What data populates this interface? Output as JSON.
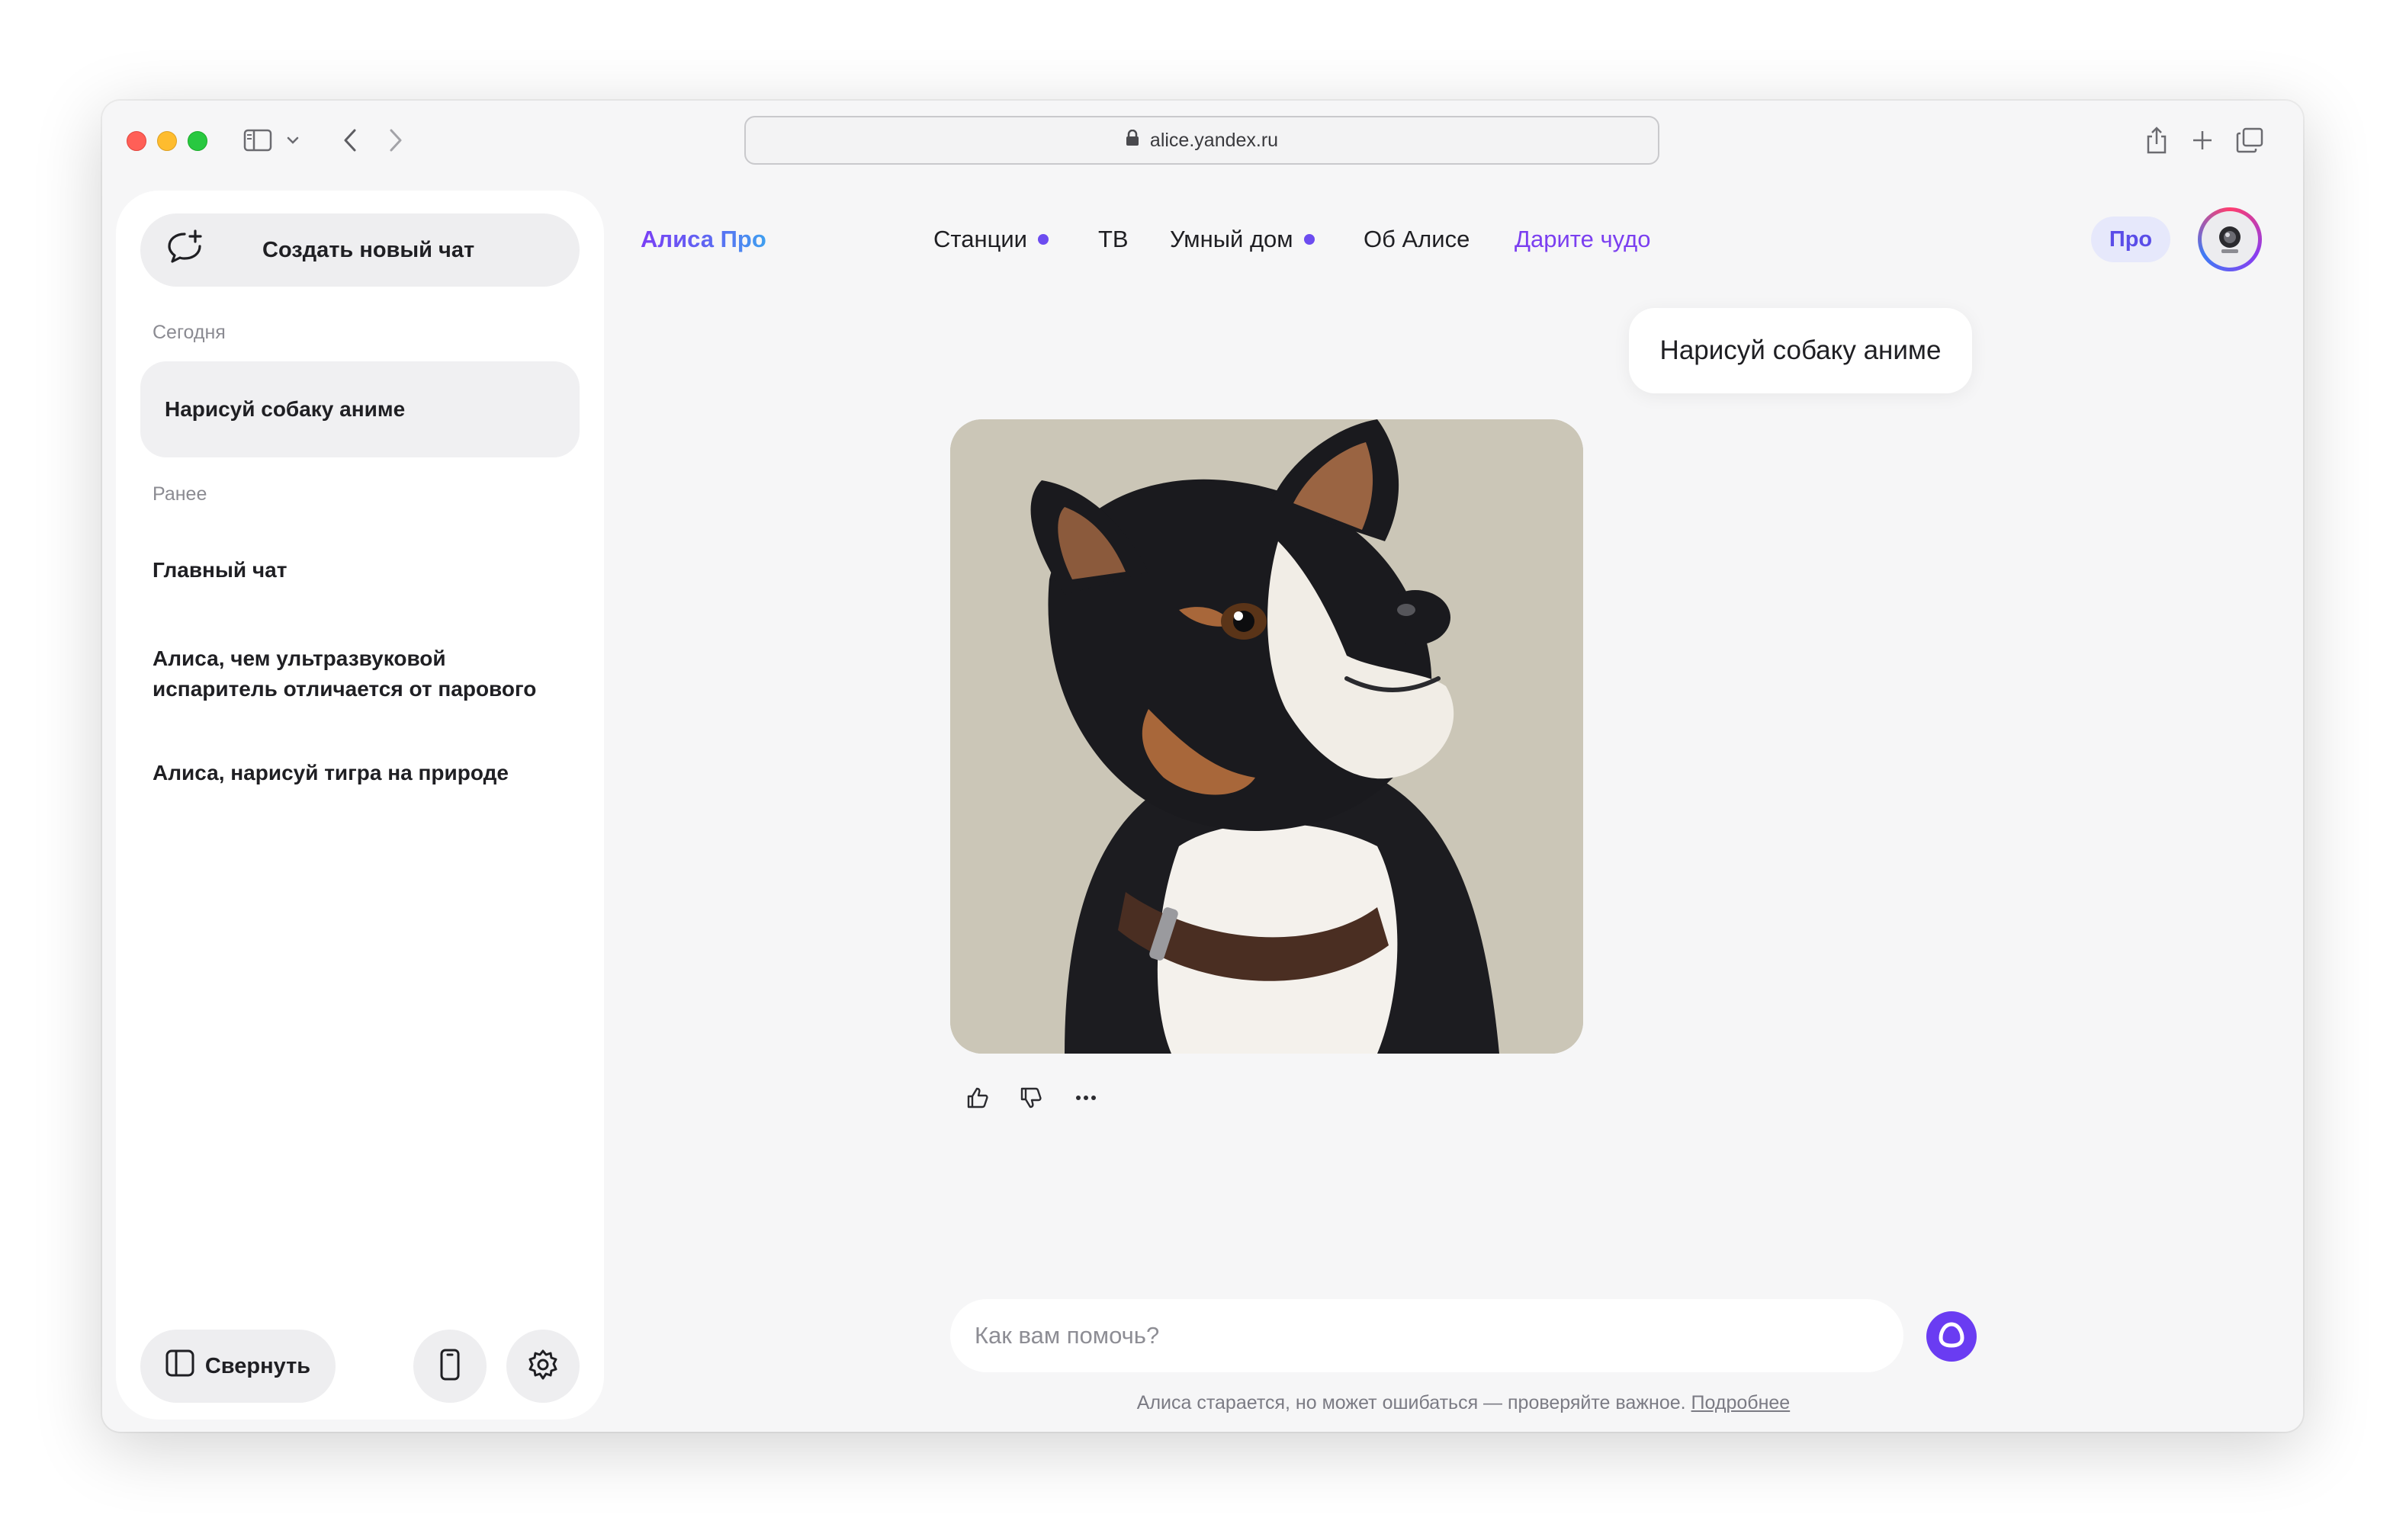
{
  "browser": {
    "url": "alice.yandex.ru"
  },
  "sidebar": {
    "new_chat_label": "Создать новый чат",
    "today_label": "Сегодня",
    "active_chat": "Нарисуй собаку аниме",
    "earlier_label": "Ранее",
    "chats": [
      "Главный чат",
      "Алиса, чем ультразвуковой испаритель отличается от парового",
      "Алиса, нарисуй тигра на природе"
    ],
    "collapse_label": "Свернуть"
  },
  "header": {
    "brand": "Алиса Про",
    "nav": [
      {
        "label": "Станции",
        "dot": true
      },
      {
        "label": "ТВ",
        "dot": false
      },
      {
        "label": "Умный дом",
        "dot": true
      },
      {
        "label": "Об Алисе",
        "dot": false
      },
      {
        "label": "Дарите чудо",
        "dot": false
      }
    ],
    "pro_badge": "Про"
  },
  "chat": {
    "user_message": "Нарисуй собаку аниме",
    "image_subject": "anime-style dog portrait"
  },
  "composer": {
    "placeholder": "Как вам помочь?",
    "disclaimer": "Алиса старается, но может ошибаться — проверяйте важное.",
    "disclaimer_link": "Подробнее"
  },
  "colors": {
    "accent": "#6a3cf2",
    "brand_gradient": [
      "#7a3ef5",
      "#3ea0f0"
    ],
    "nav_dot": "#6c4cf0"
  },
  "icons": [
    "sidebar-toggle-icon",
    "chevron-down-icon",
    "back-icon",
    "forward-icon",
    "lock-icon",
    "share-icon",
    "plus-icon",
    "tabs-icon",
    "new-chat-icon",
    "collapse-icon",
    "phone-icon",
    "gear-icon",
    "thumbs-up-icon",
    "thumbs-down-icon",
    "more-icon",
    "alice-icon"
  ]
}
